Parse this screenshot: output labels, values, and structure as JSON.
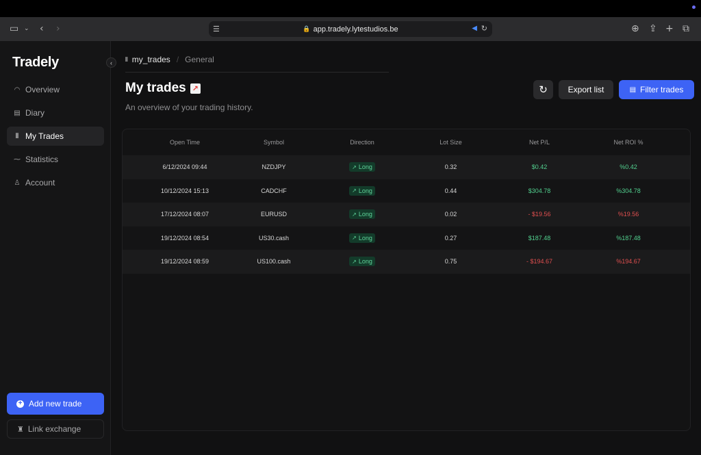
{
  "browser": {
    "url": "app.tradely.lytestudios.be"
  },
  "sidebar": {
    "logo": "Tradely",
    "items": [
      {
        "label": "Overview",
        "icon": "gauge-icon"
      },
      {
        "label": "Diary",
        "icon": "calendar-icon"
      },
      {
        "label": "My Trades",
        "icon": "candles-icon",
        "active": true
      },
      {
        "label": "Statistics",
        "icon": "trend-icon"
      },
      {
        "label": "Account",
        "icon": "user-icon"
      }
    ],
    "add_trade": "Add new trade",
    "link_exchange": "Link exchange"
  },
  "breadcrumb": {
    "current": "my_trades",
    "next": "General"
  },
  "header": {
    "title": "My trades",
    "title_emoji": "chart-increasing-icon",
    "subtitle": "An overview of your trading history.",
    "export_label": "Export list",
    "filter_label": "Filter trades"
  },
  "table": {
    "columns": [
      "Open Time",
      "Symbol",
      "Direction",
      "Lot Size",
      "Net P/L",
      "Net ROI %"
    ],
    "rows": [
      {
        "open_time": "6/12/2024 09:44",
        "symbol": "NZDJPY",
        "direction": "Long",
        "lot": "0.32",
        "pl": "$0.42",
        "roi": "%0.42",
        "positive": true
      },
      {
        "open_time": "10/12/2024 15:13",
        "symbol": "CADCHF",
        "direction": "Long",
        "lot": "0.44",
        "pl": "$304.78",
        "roi": "%304.78",
        "positive": true
      },
      {
        "open_time": "17/12/2024 08:07",
        "symbol": "EURUSD",
        "direction": "Long",
        "lot": "0.02",
        "pl": "- $19.56",
        "roi": "%19.56",
        "positive": false
      },
      {
        "open_time": "19/12/2024 08:54",
        "symbol": "US30.cash",
        "direction": "Long",
        "lot": "0.27",
        "pl": "$187.48",
        "roi": "%187.48",
        "positive": true
      },
      {
        "open_time": "19/12/2024 08:59",
        "symbol": "US100.cash",
        "direction": "Long",
        "lot": "0.75",
        "pl": "- $194.67",
        "roi": "%194.67",
        "positive": false
      }
    ]
  },
  "colors": {
    "accent": "#3d63f5",
    "positive": "#52d18f",
    "negative": "#e04f4f"
  }
}
